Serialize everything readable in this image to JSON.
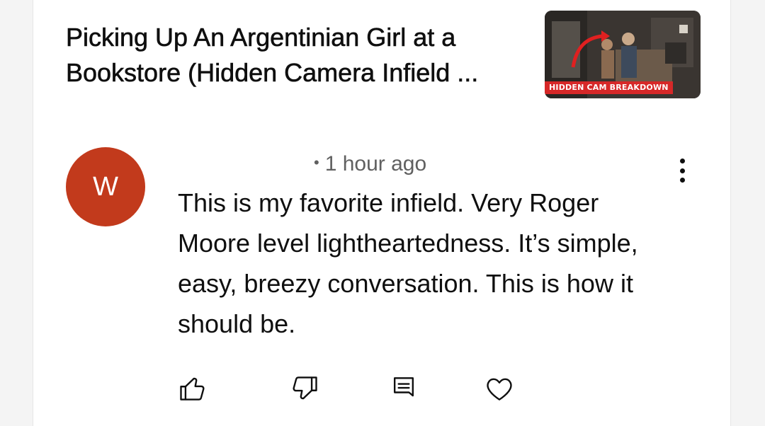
{
  "video": {
    "title": "Picking Up An Argentinian Girl at a\nBookstore (Hidden Camera Infield ...",
    "thumbnail_banner": "HIDDEN CAM BREAKDOWN"
  },
  "comment": {
    "avatar_letter": "W",
    "timestamp": "1 hour ago",
    "text": "This is my favorite infield. Very Roger\nMoore level lightheartedness. It’s simple,\neasy, breezy conversation. This is how it\nshould be."
  },
  "icons": {
    "like": "thumbs-up-icon",
    "dislike": "thumbs-down-icon",
    "reply": "reply-icon",
    "heart": "heart-icon",
    "more": "more-vertical-icon"
  },
  "colors": {
    "avatar_bg": "#c23a1c",
    "banner_bg": "#d62828",
    "text_primary": "#0f0f0f",
    "text_secondary": "#606060"
  }
}
